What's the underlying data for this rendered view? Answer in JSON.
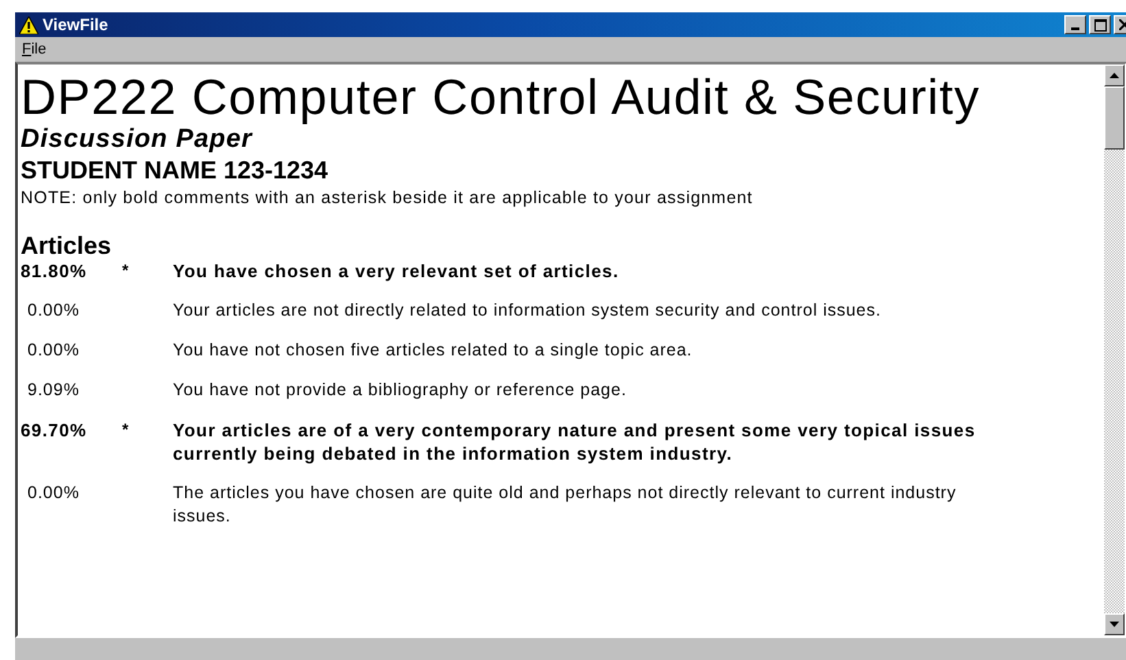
{
  "window": {
    "title": "ViewFile"
  },
  "menu": [
    {
      "label": "File"
    }
  ],
  "document": {
    "heading": "DP222 Computer Control Audit & Security",
    "subtitle": "Discussion Paper",
    "student": "STUDENT NAME 123-1234",
    "note": "NOTE: only bold comments with an asterisk beside it are applicable to your assignment",
    "section": "Articles",
    "rows": [
      {
        "score": "81.80%",
        "mark": "*",
        "bold": true,
        "comment": "You have chosen a very relevant set of articles."
      },
      {
        "score": "0.00%",
        "bold": false,
        "comment": "Your articles are not directly related to information system security and control issues."
      },
      {
        "score": "0.00%",
        "bold": false,
        "comment": "You have not chosen five articles related to a single topic area."
      },
      {
        "score": "9.09%",
        "bold": false,
        "comment": "You have not provide a bibliography or reference page."
      },
      {
        "score": "69.70%",
        "mark": "*",
        "bold": true,
        "comment": "Your articles are of a very contemporary nature and present some very topical issues currently being debated in the information system industry."
      },
      {
        "score": "0.00%",
        "bold": false,
        "comment": "The articles you have chosen are quite old and perhaps not directly relevant to current industry issues."
      }
    ]
  }
}
